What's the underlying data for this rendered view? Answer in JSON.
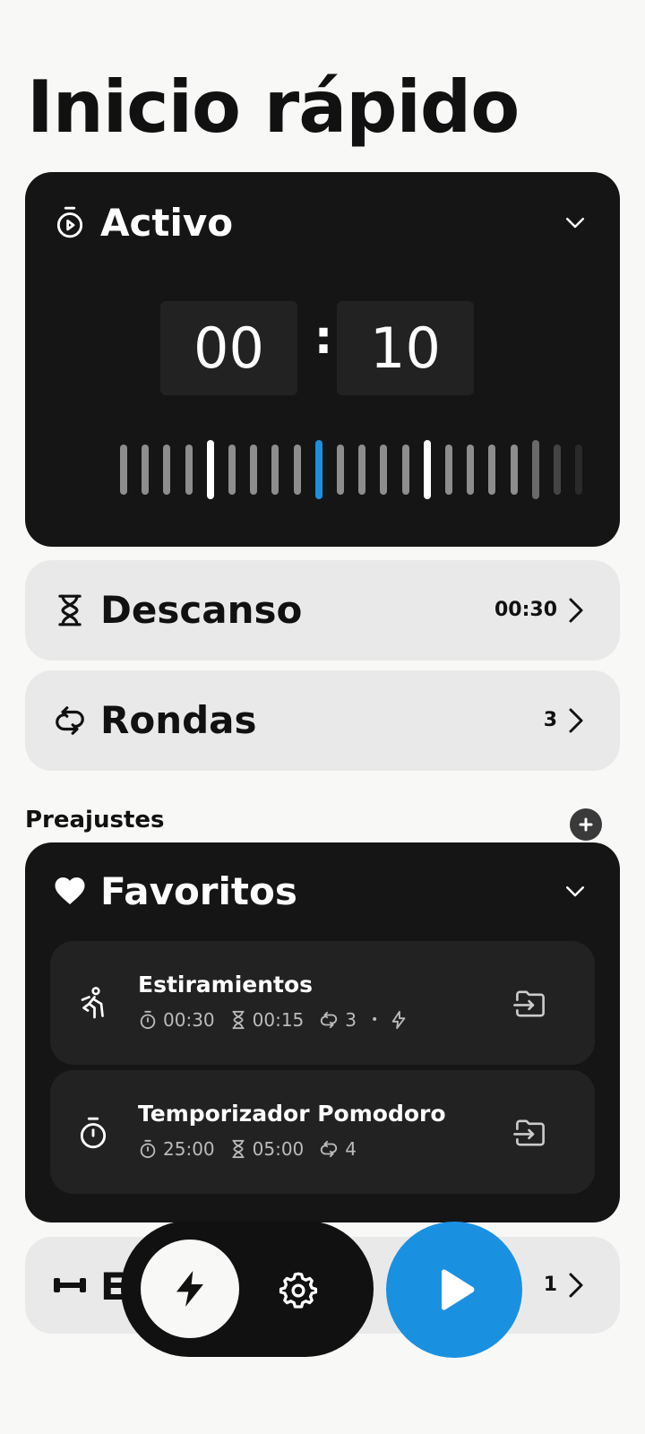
{
  "page": {
    "title": "Inicio rápido"
  },
  "active": {
    "label": "Activo",
    "minutes": "00",
    "separator": ":",
    "seconds": "10"
  },
  "rest": {
    "label": "Descanso",
    "value": "00:30"
  },
  "rounds": {
    "label": "Rondas",
    "value": "3"
  },
  "exercises": {
    "label": "E",
    "value": "1"
  },
  "presets": {
    "title": "Preajustes",
    "favorites": {
      "label": "Favoritos",
      "items": [
        {
          "name": "Estiramientos",
          "active": "00:30",
          "rest": "00:15",
          "rounds": "3",
          "dot": "•"
        },
        {
          "name": "Temporizador Pomodoro",
          "active": "25:00",
          "rest": "05:00",
          "rounds": "4"
        }
      ]
    }
  },
  "colors": {
    "accent": "#1a90e1",
    "dark": "#151515",
    "light_card": "#eae9ea",
    "background": "#f8f8f6"
  }
}
